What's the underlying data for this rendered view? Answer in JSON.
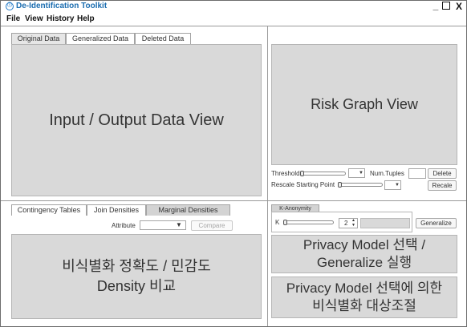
{
  "window": {
    "title": "De-Identification Toolkit",
    "icon": "de-identification-app-icon",
    "minimize_label": "_",
    "maximize_label": "□",
    "close_label": "X"
  },
  "menu": {
    "items": [
      "File",
      "View",
      "History",
      "Help"
    ]
  },
  "data_view": {
    "tabs": [
      "Original Data",
      "Generalized Data",
      "Deleted Data"
    ],
    "active_tab": "Original Data",
    "panel_text": "Input / Output Data View"
  },
  "risk_view": {
    "panel_text": "Risk Graph View",
    "threshold_label": "Threshold",
    "num_tuples_label": "Num.Tuples",
    "delete_button": "Delete",
    "rescale_label": "Rescale Starting Point",
    "rescale_button": "Recale"
  },
  "density_view": {
    "tabs": [
      "Contingency Tables",
      "Join Densities",
      "Marginal Densities"
    ],
    "selected_tab": "Marginal Densities",
    "attribute_label": "Attribute",
    "compare_button": "Compare",
    "panel_line1": "비식별화 정확도 / 민감도",
    "panel_line2": "Density 비교"
  },
  "privacy_model": {
    "tab": "K-Anonymity",
    "k_label": "K",
    "k_value": "2",
    "generalize_button": "Generalize",
    "panel1_line1": "Privacy Model 선택 /",
    "panel1_line2": "Generalize 실행",
    "panel2_line1": "Privacy Model 선택에 의한",
    "panel2_line2": "비식별화 대상조절"
  },
  "colors": {
    "title": "#1b6db0",
    "panel": "#d9d9d9",
    "border": "#9a9a9a"
  }
}
